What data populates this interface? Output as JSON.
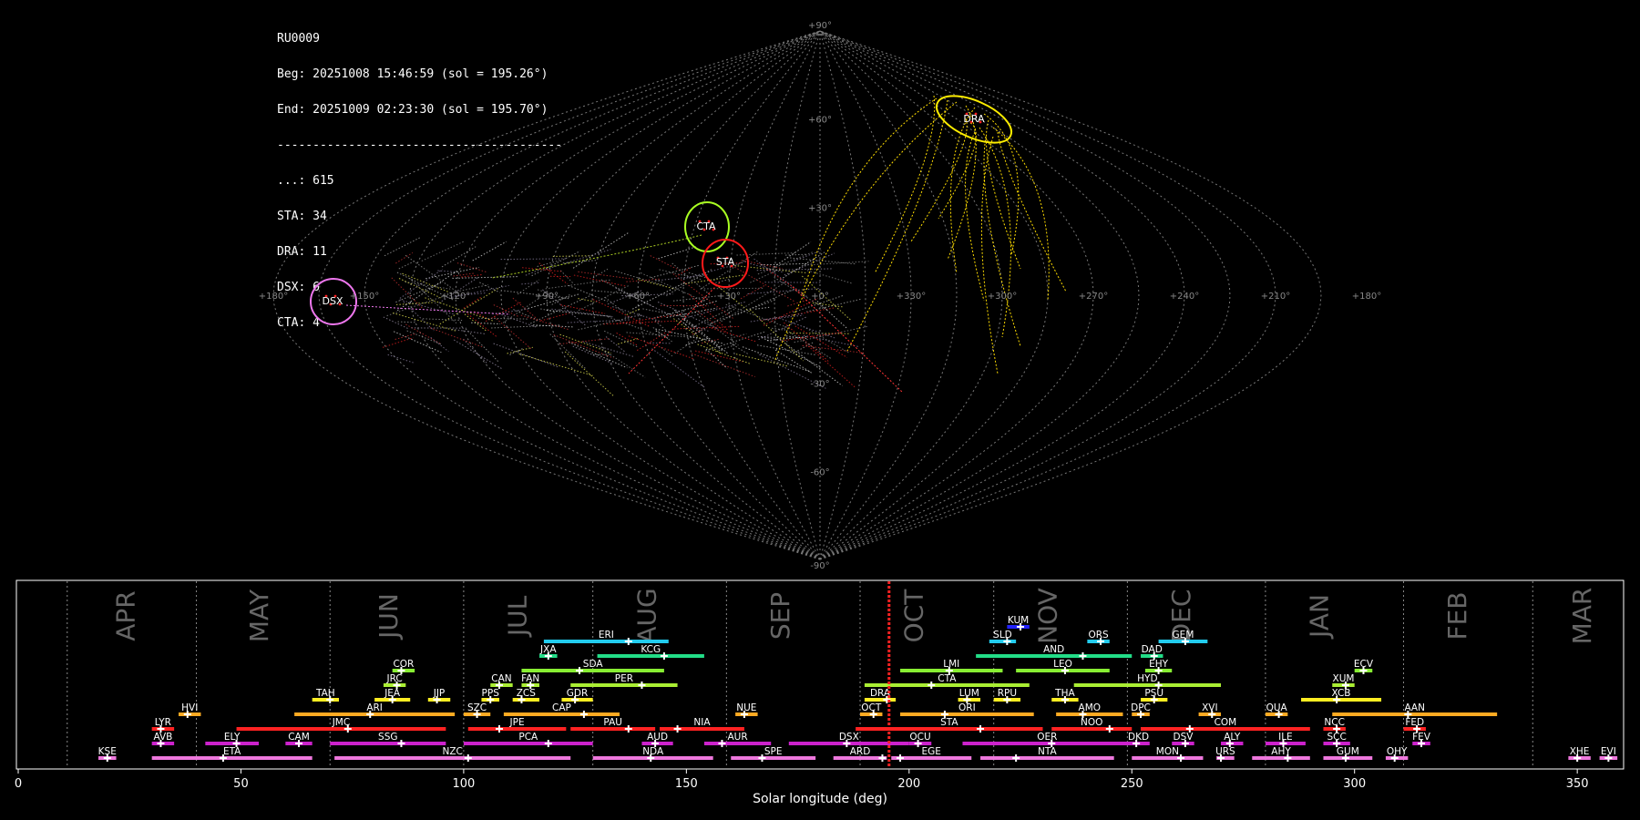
{
  "info": {
    "station": "RU0009",
    "beg": "Beg: 20251008 15:46:59 (sol = 195.26°)",
    "end": "End: 20251009 02:23:30 (sol = 195.70°)",
    "divider": "----------------------------------------",
    "counts": [
      "...: 615",
      "STA: 34",
      "DRA: 11",
      "DSX: 6",
      "CTA: 4"
    ]
  },
  "sky_map": {
    "projection": "sinusoidal",
    "lat_labels": [
      "+90°",
      "+60°",
      "+30°",
      "+0°",
      "-30°",
      "-60°",
      "-90°"
    ],
    "lon_labels": [
      "+180°",
      "+150°",
      "+120°",
      "+90°",
      "+60°",
      "+30°",
      "+0°",
      "+330°",
      "+300°",
      "+270°",
      "+240°",
      "+210°",
      "+180°"
    ],
    "radiants": [
      {
        "name": "DRA",
        "color": "#ffee00"
      },
      {
        "name": "CTA",
        "color": "#aaff22"
      },
      {
        "name": "STA",
        "color": "#ff1a1a"
      },
      {
        "name": "DSX",
        "color": "#ee77ee"
      }
    ]
  },
  "chart_data": {
    "type": "timeline",
    "xlabel": "Solar longitude (deg)",
    "xlim": [
      0,
      360
    ],
    "xticks": [
      "0",
      "50",
      "100",
      "150",
      "200",
      "250",
      "300",
      "350"
    ],
    "current_sol": 195.5,
    "months": [
      {
        "name": "APR",
        "at": 24
      },
      {
        "name": "MAY",
        "at": 54
      },
      {
        "name": "JUN",
        "at": 83
      },
      {
        "name": "JUL",
        "at": 112
      },
      {
        "name": "AUG",
        "at": 141
      },
      {
        "name": "SEP",
        "at": 171
      },
      {
        "name": "OCT",
        "at": 201
      },
      {
        "name": "NOV",
        "at": 231
      },
      {
        "name": "DEC",
        "at": 261
      },
      {
        "name": "JAN",
        "at": 292
      },
      {
        "name": "FEB",
        "at": 323
      },
      {
        "name": "MAR",
        "at": 351
      }
    ],
    "month_boundaries": [
      11,
      40,
      70,
      100,
      129,
      159,
      189,
      219,
      249,
      280,
      311,
      340
    ],
    "showers": [
      {
        "code": "KUM",
        "start": 222,
        "end": 227,
        "peak": 225,
        "row": 9,
        "color": "#2222ff"
      },
      {
        "code": "ERI",
        "start": 118,
        "end": 146,
        "peak": 137,
        "row": 8,
        "color": "#22ccee"
      },
      {
        "code": "SLD",
        "start": 218,
        "end": 224,
        "peak": 222,
        "row": 8,
        "color": "#22ccee"
      },
      {
        "code": "ORS",
        "start": 240,
        "end": 245,
        "peak": 243,
        "row": 8,
        "color": "#22ccee"
      },
      {
        "code": "GEM",
        "start": 256,
        "end": 267,
        "peak": 262,
        "row": 8,
        "color": "#22ccee"
      },
      {
        "code": "JXA",
        "start": 117,
        "end": 121,
        "peak": 119,
        "row": 7,
        "color": "#22dd88"
      },
      {
        "code": "KCG",
        "start": 130,
        "end": 154,
        "peak": 145,
        "row": 7,
        "color": "#22dd88"
      },
      {
        "code": "AND",
        "start": 215,
        "end": 250,
        "peak": 239,
        "row": 7,
        "color": "#22dd88"
      },
      {
        "code": "DAD",
        "start": 252,
        "end": 257,
        "peak": 255,
        "row": 7,
        "color": "#22dd88"
      },
      {
        "code": "COR",
        "start": 84,
        "end": 89,
        "peak": 86,
        "row": 6,
        "color": "#88ee33"
      },
      {
        "code": "SDA",
        "start": 113,
        "end": 145,
        "peak": 126,
        "row": 6,
        "color": "#88ee33"
      },
      {
        "code": "LMI",
        "start": 198,
        "end": 221,
        "peak": 209,
        "row": 6,
        "color": "#88ee33"
      },
      {
        "code": "LEO",
        "start": 224,
        "end": 245,
        "peak": 235,
        "row": 6,
        "color": "#88ee33"
      },
      {
        "code": "EHY",
        "start": 253,
        "end": 259,
        "peak": 256,
        "row": 6,
        "color": "#88ee33"
      },
      {
        "code": "ECV",
        "start": 300,
        "end": 304,
        "peak": 302,
        "row": 6,
        "color": "#88ee33"
      },
      {
        "code": "JRC",
        "start": 82,
        "end": 87,
        "peak": 85,
        "row": 5,
        "color": "#aaee33"
      },
      {
        "code": "CAN",
        "start": 106,
        "end": 111,
        "peak": 108,
        "row": 5,
        "color": "#aaee33"
      },
      {
        "code": "FAN",
        "start": 113,
        "end": 117,
        "peak": 115,
        "row": 5,
        "color": "#aaee33"
      },
      {
        "code": "PER",
        "start": 124,
        "end": 148,
        "peak": 140,
        "row": 5,
        "color": "#aaee33"
      },
      {
        "code": "CTA",
        "start": 190,
        "end": 227,
        "peak": 205,
        "row": 5,
        "color": "#aaee33"
      },
      {
        "code": "HYD",
        "start": 237,
        "end": 270,
        "peak": 256,
        "row": 5,
        "color": "#aaee33"
      },
      {
        "code": "XUM",
        "start": 295,
        "end": 300,
        "peak": 298,
        "row": 5,
        "color": "#aaee33"
      },
      {
        "code": "TAH",
        "start": 66,
        "end": 72,
        "peak": 70,
        "row": 4,
        "color": "#ffee22"
      },
      {
        "code": "JEA",
        "start": 80,
        "end": 88,
        "peak": 84,
        "row": 4,
        "color": "#ffee22"
      },
      {
        "code": "JIP",
        "start": 92,
        "end": 97,
        "peak": 94,
        "row": 4,
        "color": "#ffee22"
      },
      {
        "code": "PPS",
        "start": 104,
        "end": 108,
        "peak": 106,
        "row": 4,
        "color": "#ffee22"
      },
      {
        "code": "ZCS",
        "start": 111,
        "end": 117,
        "peak": 113,
        "row": 4,
        "color": "#ffee22"
      },
      {
        "code": "GDR",
        "start": 122,
        "end": 129,
        "peak": 125,
        "row": 4,
        "color": "#ffee22"
      },
      {
        "code": "DRA",
        "start": 190,
        "end": 197,
        "peak": 195,
        "row": 4,
        "color": "#ffee22"
      },
      {
        "code": "LUM",
        "start": 211,
        "end": 216,
        "peak": 213,
        "row": 4,
        "color": "#ffee22"
      },
      {
        "code": "RPU",
        "start": 219,
        "end": 225,
        "peak": 222,
        "row": 4,
        "color": "#ffee22"
      },
      {
        "code": "THA",
        "start": 232,
        "end": 238,
        "peak": 235,
        "row": 4,
        "color": "#ffee22"
      },
      {
        "code": "PSU",
        "start": 252,
        "end": 258,
        "peak": 255,
        "row": 4,
        "color": "#ffee22"
      },
      {
        "code": "XCB",
        "start": 288,
        "end": 306,
        "peak": 296,
        "row": 4,
        "color": "#ffee22"
      },
      {
        "code": "HVI",
        "start": 36,
        "end": 41,
        "peak": 38,
        "row": 3,
        "color": "#ffaa22"
      },
      {
        "code": "ARI",
        "start": 62,
        "end": 98,
        "peak": 79,
        "row": 3,
        "color": "#ffaa22"
      },
      {
        "code": "SZC",
        "start": 100,
        "end": 106,
        "peak": 103,
        "row": 3,
        "color": "#ffaa22"
      },
      {
        "code": "CAP",
        "start": 109,
        "end": 135,
        "peak": 127,
        "row": 3,
        "color": "#ffaa22"
      },
      {
        "code": "NUE",
        "start": 161,
        "end": 166,
        "peak": 163,
        "row": 3,
        "color": "#ffaa22"
      },
      {
        "code": "OCT",
        "start": 189,
        "end": 194,
        "peak": 192,
        "row": 3,
        "color": "#ffaa22"
      },
      {
        "code": "ORI",
        "start": 198,
        "end": 228,
        "peak": 208,
        "row": 3,
        "color": "#ffaa22"
      },
      {
        "code": "AMO",
        "start": 233,
        "end": 248,
        "peak": 239,
        "row": 3,
        "color": "#ffaa22"
      },
      {
        "code": "DPC",
        "start": 250,
        "end": 254,
        "peak": 252,
        "row": 3,
        "color": "#ffaa22"
      },
      {
        "code": "XVI",
        "start": 265,
        "end": 270,
        "peak": 268,
        "row": 3,
        "color": "#ffaa22"
      },
      {
        "code": "QUA",
        "start": 280,
        "end": 285,
        "peak": 283,
        "row": 3,
        "color": "#ffaa22"
      },
      {
        "code": "AAN",
        "start": 295,
        "end": 332,
        "peak": 312,
        "row": 3,
        "color": "#ffaa22"
      },
      {
        "code": "LYR",
        "start": 30,
        "end": 35,
        "peak": 32,
        "row": 2,
        "color": "#ff2222"
      },
      {
        "code": "JMC",
        "start": 49,
        "end": 96,
        "peak": 74,
        "row": 2,
        "color": "#ff2222"
      },
      {
        "code": "JPE",
        "start": 101,
        "end": 123,
        "peak": 108,
        "row": 2,
        "color": "#ff2222"
      },
      {
        "code": "PAU",
        "start": 124,
        "end": 143,
        "peak": 137,
        "row": 2,
        "color": "#ff2222"
      },
      {
        "code": "NIA",
        "start": 144,
        "end": 163,
        "peak": 148,
        "row": 2,
        "color": "#ff2222"
      },
      {
        "code": "STA",
        "start": 188,
        "end": 230,
        "peak": 216,
        "row": 2,
        "color": "#ff2222"
      },
      {
        "code": "NOO",
        "start": 232,
        "end": 250,
        "peak": 245,
        "row": 2,
        "color": "#ff2222"
      },
      {
        "code": "COM",
        "start": 252,
        "end": 290,
        "peak": 263,
        "row": 2,
        "color": "#ff2222"
      },
      {
        "code": "NCC",
        "start": 293,
        "end": 298,
        "peak": 296,
        "row": 2,
        "color": "#ff2222"
      },
      {
        "code": "FED",
        "start": 311,
        "end": 316,
        "peak": 314,
        "row": 2,
        "color": "#ff2222"
      },
      {
        "code": "AVB",
        "start": 30,
        "end": 35,
        "peak": 32,
        "row": 1,
        "color": "#cc22cc"
      },
      {
        "code": "ELY",
        "start": 42,
        "end": 54,
        "peak": 49,
        "row": 1,
        "color": "#cc22cc"
      },
      {
        "code": "CAM",
        "start": 60,
        "end": 66,
        "peak": 63,
        "row": 1,
        "color": "#cc22cc"
      },
      {
        "code": "SSG",
        "start": 70,
        "end": 96,
        "peak": 86,
        "row": 1,
        "color": "#cc22cc"
      },
      {
        "code": "PCA",
        "start": 100,
        "end": 129,
        "peak": 119,
        "row": 1,
        "color": "#cc22cc"
      },
      {
        "code": "AUD",
        "start": 140,
        "end": 147,
        "peak": 143,
        "row": 1,
        "color": "#cc22cc"
      },
      {
        "code": "AUR",
        "start": 154,
        "end": 169,
        "peak": 158,
        "row": 1,
        "color": "#cc22cc"
      },
      {
        "code": "DSX",
        "start": 173,
        "end": 200,
        "peak": 186,
        "row": 1,
        "color": "#cc22cc"
      },
      {
        "code": "OCU",
        "start": 200,
        "end": 205,
        "peak": 202,
        "row": 1,
        "color": "#cc22cc"
      },
      {
        "code": "OER",
        "start": 212,
        "end": 250,
        "peak": 232,
        "row": 1,
        "color": "#cc22cc"
      },
      {
        "code": "DKD",
        "start": 249,
        "end": 254,
        "peak": 251,
        "row": 1,
        "color": "#cc22cc"
      },
      {
        "code": "DSV",
        "start": 259,
        "end": 264,
        "peak": 262,
        "row": 1,
        "color": "#cc22cc"
      },
      {
        "code": "ALY",
        "start": 270,
        "end": 275,
        "peak": 272,
        "row": 1,
        "color": "#cc22cc"
      },
      {
        "code": "ILE",
        "start": 280,
        "end": 289,
        "peak": 284,
        "row": 1,
        "color": "#cc22cc"
      },
      {
        "code": "SCC",
        "start": 293,
        "end": 299,
        "peak": 296,
        "row": 1,
        "color": "#cc22cc"
      },
      {
        "code": "FEV",
        "start": 313,
        "end": 317,
        "peak": 315,
        "row": 1,
        "color": "#cc22cc"
      },
      {
        "code": "KSE",
        "start": 18,
        "end": 22,
        "peak": 20,
        "row": 0,
        "color": "#ee77dd"
      },
      {
        "code": "ETA",
        "start": 30,
        "end": 66,
        "peak": 46,
        "row": 0,
        "color": "#ee77dd"
      },
      {
        "code": "NZC",
        "start": 71,
        "end": 124,
        "peak": 101,
        "row": 0,
        "color": "#ee77dd"
      },
      {
        "code": "NDA",
        "start": 129,
        "end": 156,
        "peak": 142,
        "row": 0,
        "color": "#ee77dd"
      },
      {
        "code": "SPE",
        "start": 160,
        "end": 179,
        "peak": 167,
        "row": 0,
        "color": "#ee77dd"
      },
      {
        "code": "ARD",
        "start": 183,
        "end": 195,
        "peak": 194,
        "row": 0,
        "color": "#ee77dd"
      },
      {
        "code": "EGE",
        "start": 196,
        "end": 214,
        "peak": 198,
        "row": 0,
        "color": "#ee77dd"
      },
      {
        "code": "NTA",
        "start": 216,
        "end": 246,
        "peak": 224,
        "row": 0,
        "color": "#ee77dd"
      },
      {
        "code": "MON",
        "start": 250,
        "end": 266,
        "peak": 261,
        "row": 0,
        "color": "#ee77dd"
      },
      {
        "code": "URS",
        "start": 269,
        "end": 273,
        "peak": 270,
        "row": 0,
        "color": "#ee77dd"
      },
      {
        "code": "AHY",
        "start": 277,
        "end": 290,
        "peak": 285,
        "row": 0,
        "color": "#ee77dd"
      },
      {
        "code": "GUM",
        "start": 293,
        "end": 304,
        "peak": 298,
        "row": 0,
        "color": "#ee77dd"
      },
      {
        "code": "OHY",
        "start": 307,
        "end": 312,
        "peak": 309,
        "row": 0,
        "color": "#ee77dd"
      },
      {
        "code": "XHE",
        "start": 348,
        "end": 353,
        "peak": 350,
        "row": 0,
        "color": "#ee77dd"
      },
      {
        "code": "EVI",
        "start": 355,
        "end": 359,
        "peak": 357,
        "row": 0,
        "color": "#ee77dd"
      }
    ]
  }
}
